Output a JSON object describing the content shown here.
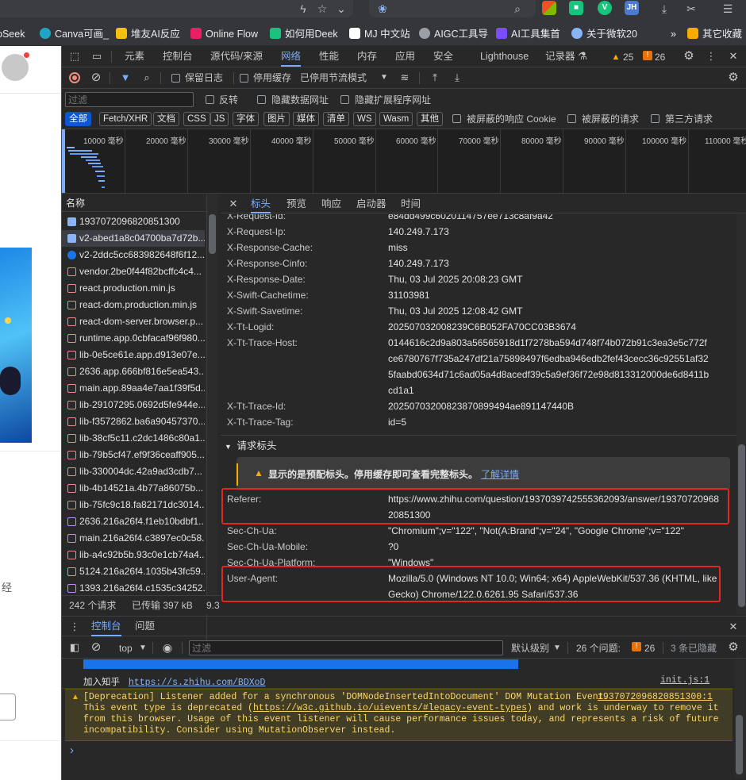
{
  "topbar": {
    "icons": [
      "lightning-icon",
      "star-icon",
      "chevron-down-icon",
      "paw-icon",
      "search-icon",
      "windows-icon",
      "green-ext-icon",
      "v-ext-icon",
      "jh-ext-icon",
      "download-icon",
      "share-icon",
      "menu-icon"
    ],
    "jh_label": "JH",
    "v_label": "V"
  },
  "bookmarks": [
    {
      "label": "pSeek",
      "color": "#4d6bfe"
    },
    {
      "label": "Canva可画_",
      "color": "#1fa6c4"
    },
    {
      "label": "堆友AI反应",
      "color": "#f4c20d"
    },
    {
      "label": "Online Flow",
      "color": "#e91e63"
    },
    {
      "label": "如何用Deek",
      "color": "#19c37d"
    },
    {
      "label": "MJ 中文站",
      "color": "#ffffff"
    },
    {
      "label": "AIGC工具导",
      "color": "#9aa0a6"
    },
    {
      "label": "AI工具集首",
      "color": "#7c4dff"
    },
    {
      "label": "关于微软20",
      "color": "#8ab4f8"
    },
    {
      "label": "其它收藏",
      "color": "#f9ab00"
    }
  ],
  "devtools": {
    "main_tabs": [
      "元素",
      "控制台",
      "源代码/来源",
      "网络",
      "性能",
      "内存",
      "应用",
      "安全",
      "Lighthouse",
      "记录器"
    ],
    "active_main_tab": "网络",
    "warnings_count": "25",
    "errors_count": "26",
    "net_toolbar": {
      "preserve_log": "保留日志",
      "disable_cache": "停用缓存",
      "throttle": "已停用节流模式"
    },
    "filter": {
      "placeholder": "过滤",
      "invert": "反转",
      "hide_data_urls": "隐藏数据网址",
      "hide_ext_urls": "隐藏扩展程序网址"
    },
    "type_chips": [
      "全部",
      "Fetch/XHR",
      "文档",
      "CSS",
      "JS",
      "字体",
      "图片",
      "媒体",
      "清单",
      "WS",
      "Wasm",
      "其他"
    ],
    "blocked_cookies": "被屏蔽的响应 Cookie",
    "blocked_requests": "被屏蔽的请求",
    "third_party": "第三方请求",
    "timeline_labels": [
      "10000 毫秒",
      "20000 毫秒",
      "30000 毫秒",
      "40000 毫秒",
      "50000 毫秒",
      "60000 毫秒",
      "70000 毫秒",
      "80000 毫秒",
      "90000 毫秒",
      "100000 毫秒",
      "110000 毫秒"
    ],
    "name_column": "名称",
    "requests": [
      {
        "name": "1937072096820851300",
        "color": "#8ab4f8"
      },
      {
        "name": "v2-abed1a8c04700ba7d72b...",
        "color": "#8ab4f8"
      },
      {
        "name": "v2-2ddc5cc683982648f6f12...",
        "color": "#1a73e8"
      },
      {
        "name": "vendor.2be0f44f82bcffc4c4...",
        "color": "#f28b82"
      },
      {
        "name": "react.production.min.js",
        "color": "#f28b82"
      },
      {
        "name": "react-dom.production.min.js",
        "color": "#f28b82"
      },
      {
        "name": "react-dom-server.browser.p...",
        "color": "#f28b82"
      },
      {
        "name": "runtime.app.0cbfacaf96f980...",
        "color": "#f28b82"
      },
      {
        "name": "lib-0e5ce61e.app.d913e07e...",
        "color": "#f28b82"
      },
      {
        "name": "2636.app.666bf816e5ea543...",
        "color": "#f28b82"
      },
      {
        "name": "main.app.89aa4e7aa1f39f5d...",
        "color": "#f28b82"
      },
      {
        "name": "lib-29107295.0692d5fe944e...",
        "color": "#f28b82"
      },
      {
        "name": "lib-f3572862.ba6a90457370...",
        "color": "#f28b82"
      },
      {
        "name": "lib-38cf5c11.c2dc1486c80a1...",
        "color": "#f28b82"
      },
      {
        "name": "lib-79b5cf47.ef9f36ceaff905...",
        "color": "#f28b82"
      },
      {
        "name": "lib-330004dc.42a9ad3cdb7...",
        "color": "#f28b82"
      },
      {
        "name": "lib-4b14521a.4b77a86075b...",
        "color": "#f28b82"
      },
      {
        "name": "lib-75fc9c18.fa82171dc3014...",
        "color": "#f28b82"
      },
      {
        "name": "2636.216a26f4.f1eb10bdbf1...",
        "color": "#c58af9"
      },
      {
        "name": "main.216a26f4.c3897ec0c58...",
        "color": "#c58af9"
      },
      {
        "name": "lib-a4c92b5b.93c0e1cb74a4...",
        "color": "#f28b82"
      },
      {
        "name": "5124.216a26f4.1035b43fc59...",
        "color": "#f28b82"
      },
      {
        "name": "1393.216a26f4.c1535c34252...",
        "color": "#c58af9"
      }
    ],
    "status_bar": {
      "requests": "242 个请求",
      "transferred": "已传输 397 kB",
      "extra": "9.3"
    },
    "detail_tabs": [
      "标头",
      "预览",
      "响应",
      "启动器",
      "时间"
    ],
    "active_detail_tab": "标头",
    "response_headers": [
      {
        "key": "X-Request-Id:",
        "value": "e84dd499c6020114757ee713c8af9a42"
      },
      {
        "key": "X-Request-Ip:",
        "value": "140.249.7.173"
      },
      {
        "key": "X-Response-Cache:",
        "value": "miss"
      },
      {
        "key": "X-Response-Cinfo:",
        "value": "140.249.7.173"
      },
      {
        "key": "X-Response-Date:",
        "value": "Thu, 03 Jul 2025 20:08:23 GMT"
      },
      {
        "key": "X-Swift-Cachetime:",
        "value": "31103981"
      },
      {
        "key": "X-Swift-Savetime:",
        "value": "Thu, 03 Jul 2025 12:08:42 GMT"
      },
      {
        "key": "X-Tt-Logid:",
        "value": "202507032008239C6B052FA70CC03B3674"
      },
      {
        "key": "X-Tt-Trace-Host:",
        "value": "0144616c2d9a803a56565918d1f7278ba594d748f74b072b91c3ea3e5c772fce6780767f735a247df21a75898497f6edba946edb2fef43cecc36c92551af325faabd0634d71c6ad05a4d8acedf39c5a9ef36f72e98d813312000de6d8411bcd1a1"
      },
      {
        "key": "X-Tt-Trace-Id:",
        "value": "20250703200823870899494ae891147440B"
      },
      {
        "key": "X-Tt-Trace-Tag:",
        "value": "id=5"
      }
    ],
    "request_headers_title": "请求标头",
    "provisional_notice": "显示的是预配标头。停用缓存即可查看完整标头。",
    "learn_more": "了解详情",
    "request_headers": [
      {
        "key": "Referer:",
        "value": "https://www.zhihu.com/question/1937039742555362093/answer/1937072096820851300"
      },
      {
        "key": "Sec-Ch-Ua:",
        "value": "\"Chromium\";v=\"122\", \"Not(A:Brand\";v=\"24\", \"Google Chrome\";v=\"122\""
      },
      {
        "key": "Sec-Ch-Ua-Mobile:",
        "value": "?0"
      },
      {
        "key": "Sec-Ch-Ua-Platform:",
        "value": "\"Windows\""
      },
      {
        "key": "User-Agent:",
        "value": "Mozilla/5.0 (Windows NT 10.0; Win64; x64) AppleWebKit/537.36 (KHTML, like Gecko) Chrome/122.0.6261.95 Safari/537.36"
      }
    ],
    "drawer_tabs": [
      "控制台",
      "问题"
    ],
    "console_toolbar": {
      "context": "top",
      "filter_placeholder": "过滤",
      "level": "默认级别",
      "issues": "26 个问题:",
      "issues_count": "26",
      "hidden": "3 条已隐藏"
    },
    "console": {
      "join_text": "加入知乎",
      "join_link": "https://s.zhihu.com/BDXoD",
      "join_source": "init.js:1",
      "warn_line1": "[Deprecation] Listener added for a synchronous 'DOMNodeInsertedIntoDocument' DOM Mutation Event.",
      "warn_source": "1937072096820851300:1",
      "warn_line2_a": "This event type is deprecated (",
      "warn_link": "https://w3c.github.io/uievents/#legacy-event-types",
      "warn_line2_b": ") and work is underway to remove it",
      "warn_line3": "from this browser. Usage of this event listener will cause performance issues today, and represents a risk of future",
      "warn_line4": "incompatibility. Consider using MutationObserver instead.",
      "prompt": "›"
    }
  },
  "page": {
    "side_text": "经"
  }
}
